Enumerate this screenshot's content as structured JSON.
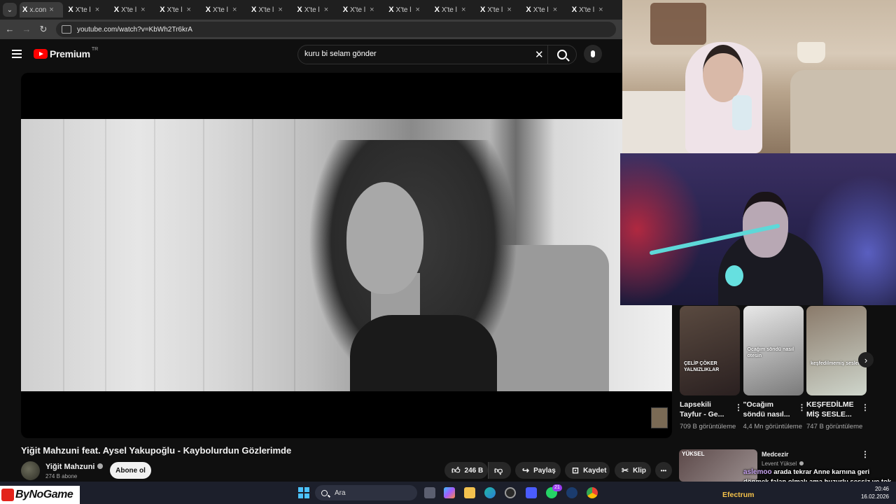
{
  "browser": {
    "tabs": [
      {
        "logo": "X",
        "label": "x.con",
        "active": true
      },
      {
        "logo": "X",
        "label": "X'te l",
        "active": false
      },
      {
        "logo": "X",
        "label": "X'te l",
        "active": false
      },
      {
        "logo": "X",
        "label": "X'te l",
        "active": false
      },
      {
        "logo": "X",
        "label": "X'te l",
        "active": false
      },
      {
        "logo": "X",
        "label": "X'te l",
        "active": false
      },
      {
        "logo": "X",
        "label": "X'te l",
        "active": false
      },
      {
        "logo": "X",
        "label": "X'te l",
        "active": false
      },
      {
        "logo": "X",
        "label": "X'te l",
        "active": false
      },
      {
        "logo": "X",
        "label": "X'te l",
        "active": false
      },
      {
        "logo": "X",
        "label": "X'te l",
        "active": false
      },
      {
        "logo": "X",
        "label": "X'te l",
        "active": false
      },
      {
        "logo": "X",
        "label": "X'te l",
        "active": false
      }
    ],
    "tab_close": "×",
    "tab_menu_icon": "⌄",
    "url": "youtube.com/watch?v=KbWh2Tr6krA",
    "nav": {
      "back": "←",
      "forward": "→",
      "reload": "↻"
    }
  },
  "youtube": {
    "logo_text": "Premium",
    "country": "TR",
    "search_value": "kuru bi selam gönder",
    "clear_icon": "✕"
  },
  "video": {
    "title": "Yiğit Mahzuni feat. Aysel Yakupoğlu - Kaybolurdun Gözlerimde",
    "channel": "Yiğit Mahzuni",
    "subscribers": "274 B abone",
    "subscribe_label": "Abone ol",
    "likes": "246 B",
    "share_label": "Paylaş",
    "save_label": "Kaydet",
    "clip_label": "Klip",
    "more_icon": "•••"
  },
  "related": [
    {
      "title": "Lapsekili Tayfur - Ge...",
      "views": "709 B görüntüleme",
      "caption": "ÇELİP ÇÖKER YALNIZLIKLAR",
      "colors": [
        "#5a4a40",
        "#2a2020"
      ]
    },
    {
      "title": "\"Ocağım söndü nasıl...",
      "views": "4,4 Mn görüntüleme",
      "caption": "Ocağım söndü nasıl ötesin",
      "colors": [
        "#e8e8e8",
        "#7a7a7a"
      ]
    },
    {
      "title": "KEŞFEDİLME MİŞ SESLE...",
      "views": "747 B görüntüleme",
      "caption": "keşfedilmemiş sesler",
      "colors": [
        "#8a7a6a",
        "#cfd6cc"
      ]
    }
  ],
  "related_next_icon": "›",
  "related_more_icon": "⋮",
  "recommended": {
    "title": "Medcezir",
    "channel": "Levent Yüksel",
    "thumb_label": "YÜKSEL"
  },
  "chat": {
    "user": "aslemoo",
    "message": "arada tekrar Anne karnına geri dönmek falan olmalı ama huzurlu sessiz ve tok takma bu kadar en sevdiğim d"
  },
  "taskbar": {
    "brand": "ByNoGame",
    "search_placeholder": "Ara",
    "badge_whatsapp": "21",
    "streamer_tag": "Efectrum",
    "time": "20:46",
    "date": "16.02.2026"
  }
}
